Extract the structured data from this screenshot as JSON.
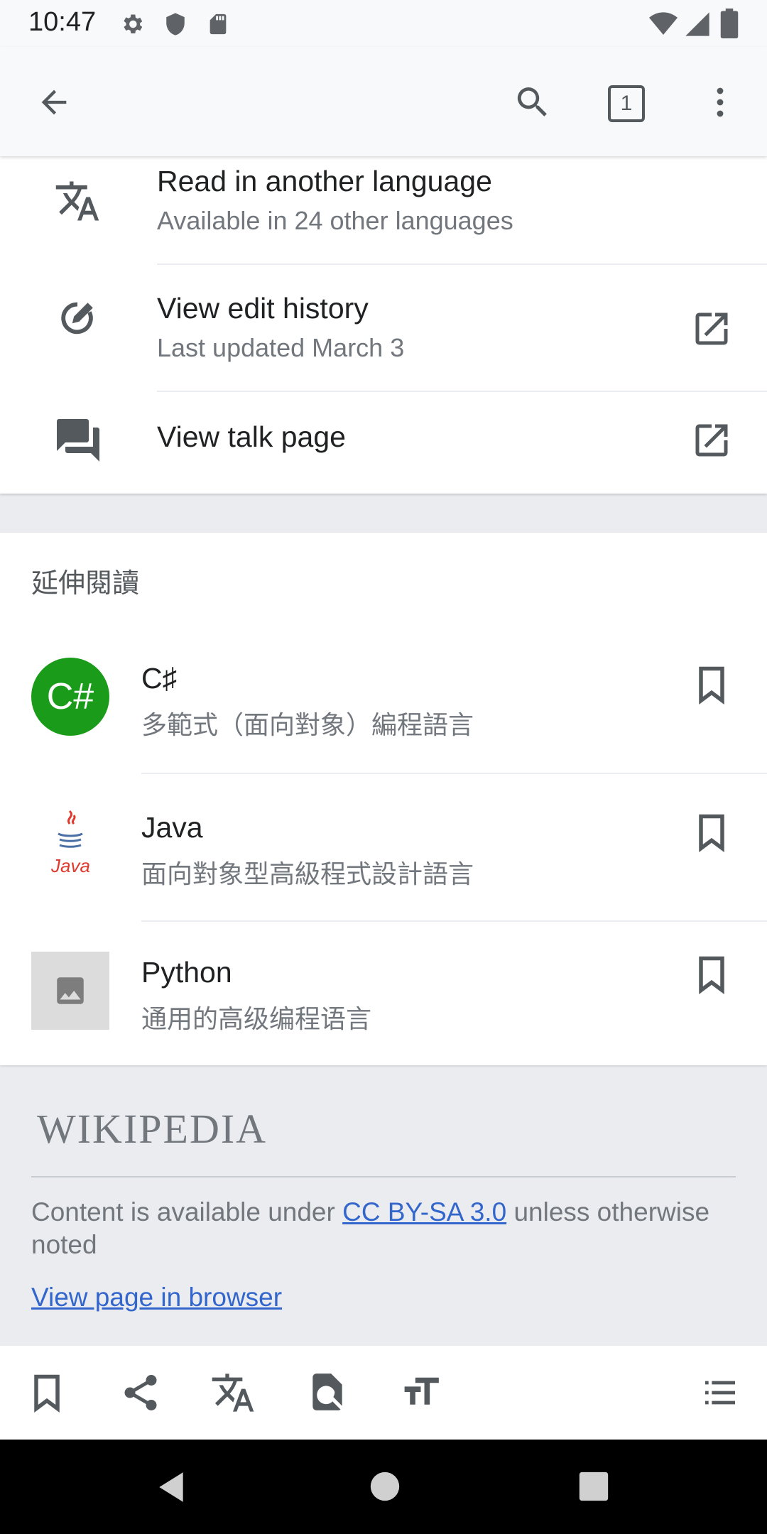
{
  "status_bar": {
    "time": "10:47"
  },
  "toolbar": {
    "tab_count": "1"
  },
  "article_actions": [
    {
      "title": "Read in another language",
      "subtitle": "Available in 24 other languages"
    },
    {
      "title": "View edit history",
      "subtitle": "Last updated March 3"
    },
    {
      "title": "View talk page"
    }
  ],
  "read_more": {
    "heading": "延伸閱讀",
    "items": [
      {
        "title": "C♯",
        "description": "多範式（面向對象）編程語言",
        "thumb_text": "C#"
      },
      {
        "title": "Java",
        "description": "面向對象型高級程式設計語言",
        "thumb_text": "Java"
      },
      {
        "title": "Python",
        "description": "通用的高级编程语言"
      }
    ]
  },
  "footer": {
    "wordmark": "WIKIPEDIA",
    "license_prefix": "Content is available under ",
    "license_link": "CC BY-SA 3.0",
    "license_suffix": " unless otherwise noted",
    "view_in_browser": "View page in browser"
  },
  "colors": {
    "link": "#3366cc",
    "csharp_green": "#1a9c1a",
    "java_red": "#e03a2f"
  }
}
